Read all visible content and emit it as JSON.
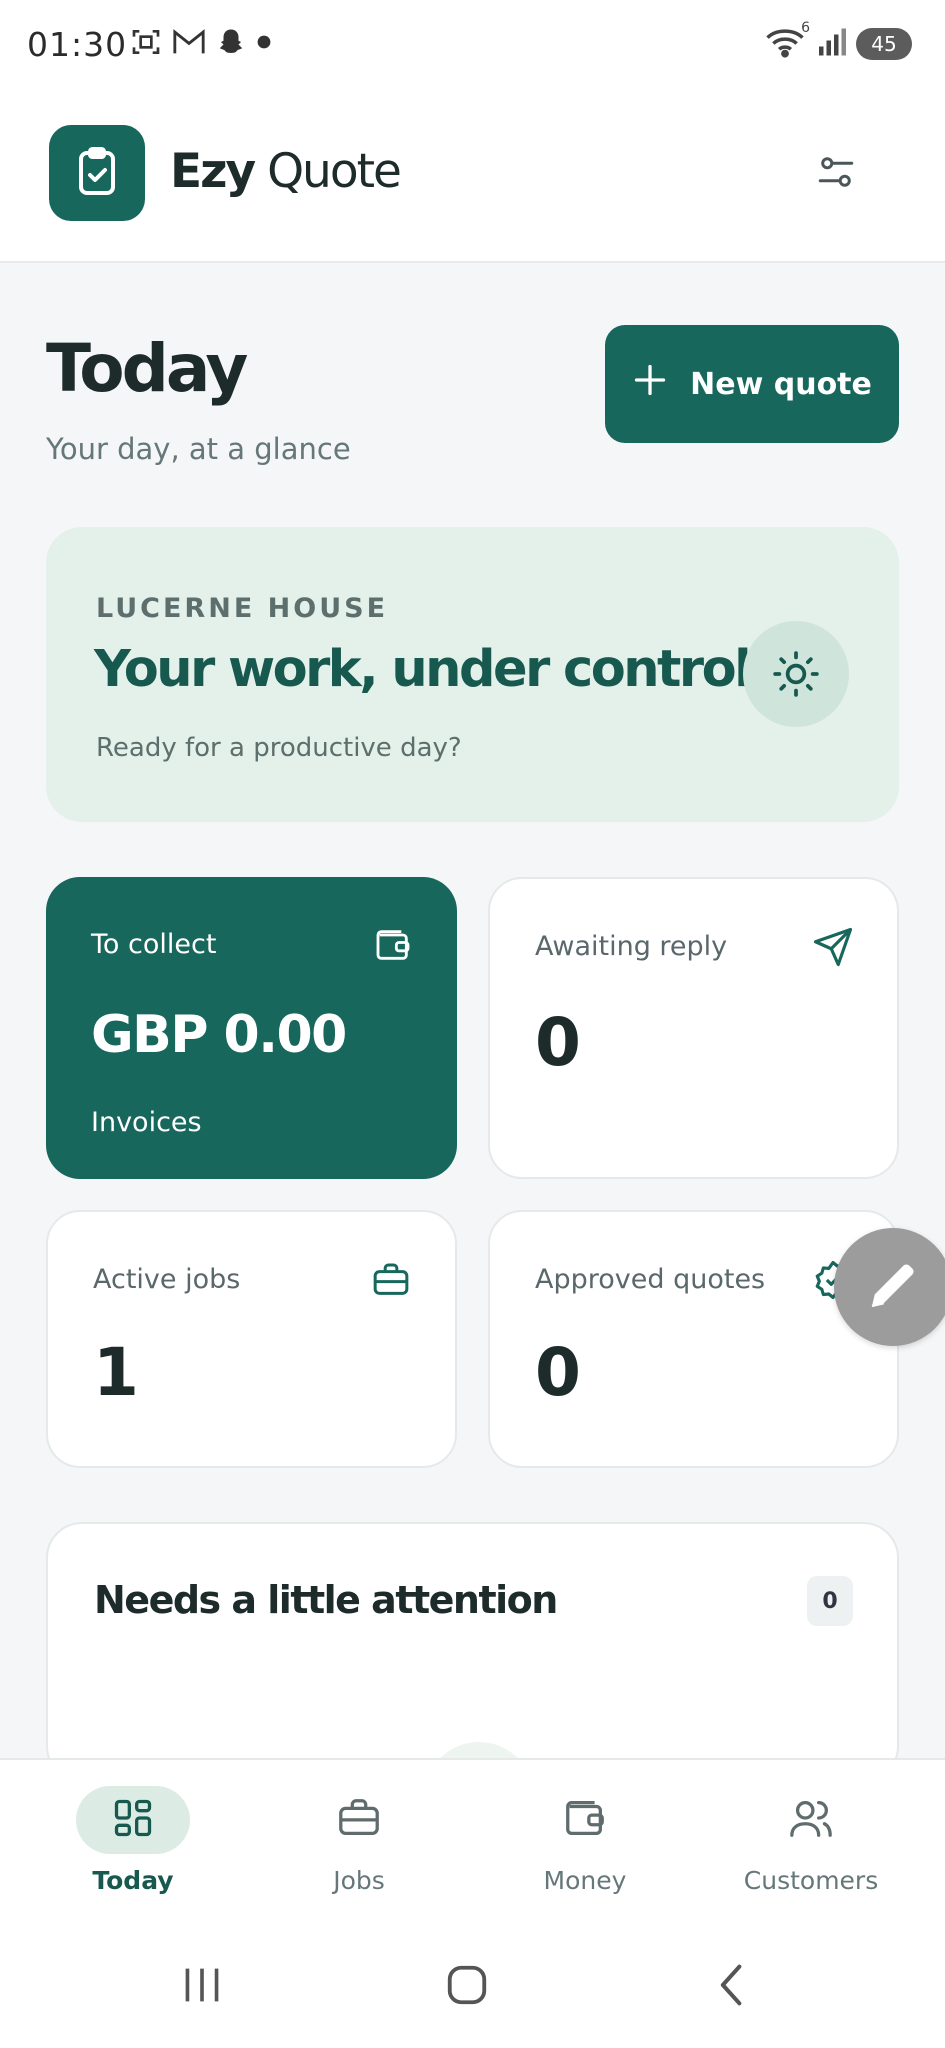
{
  "status_bar": {
    "time": "01:30",
    "battery": "45",
    "left_icons": [
      "screenshot-icon",
      "gmail-icon",
      "snapchat-icon",
      "dot-icon"
    ],
    "right_icons": [
      "wifi-icon",
      "signal-icon",
      "battery-icon"
    ],
    "wifi_badge": "6"
  },
  "header": {
    "app_name_bold": "Ezy",
    "app_name_light": "Quote",
    "logo_icon": "clipboard-check-icon",
    "filter_icon": "filter-sliders-icon"
  },
  "page": {
    "title": "Today",
    "subtitle": "Your day, at a glance",
    "new_quote_label": "New quote"
  },
  "hero": {
    "eyebrow": "LUCERNE HOUSE",
    "title": "Your work, under control.",
    "subtitle": "Ready for a productive day?",
    "icon": "sun-icon"
  },
  "stats": {
    "to_collect": {
      "label": "To collect",
      "value": "GBP 0.00",
      "sub": "Invoices",
      "icon": "wallet-icon"
    },
    "awaiting_reply": {
      "label": "Awaiting reply",
      "value": "0",
      "icon": "send-icon"
    },
    "active_jobs": {
      "label": "Active jobs",
      "value": "1",
      "icon": "briefcase-icon"
    },
    "approved_quotes": {
      "label": "Approved quotes",
      "value": "0",
      "icon": "badge-check-icon"
    }
  },
  "attention": {
    "title": "Needs a little attention",
    "count": "0"
  },
  "bottom_nav": [
    {
      "label": "Today",
      "icon": "grid-icon",
      "active": true
    },
    {
      "label": "Jobs",
      "icon": "briefcase-icon",
      "active": false
    },
    {
      "label": "Money",
      "icon": "wallet-icon",
      "active": false
    },
    {
      "label": "Customers",
      "icon": "users-icon",
      "active": false
    }
  ],
  "colors": {
    "brand": "#17675c",
    "brand_dark_text": "#17584f",
    "hero_bg": "#e4f0ea",
    "page_bg": "#f4f6f7"
  }
}
